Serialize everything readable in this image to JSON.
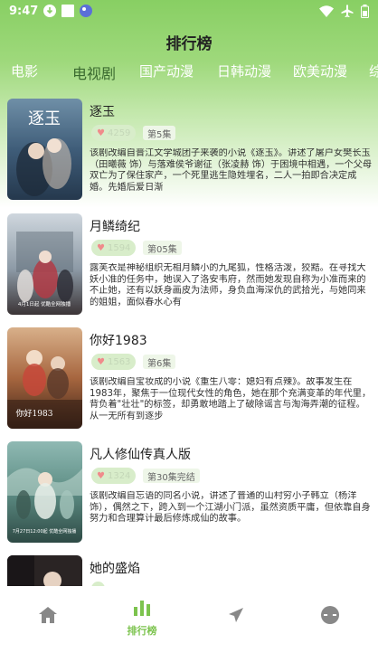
{
  "status_bar": {
    "time": "9:47"
  },
  "header": {
    "title": "排行榜"
  },
  "tabs": [
    {
      "label": "电影"
    },
    {
      "label": "电视剧"
    },
    {
      "label": "国产动漫"
    },
    {
      "label": "日韩动漫"
    },
    {
      "label": "欧美动漫"
    },
    {
      "label": "综"
    }
  ],
  "active_tab": "电视剧",
  "items": [
    {
      "title": "逐玉",
      "heat": "4259",
      "episodes": "第5集",
      "poster_caption": "逐玉",
      "description": "该剧改编自晋江文学城团子来袭的小说《逐玉》。讲述了屠户女樊长玉（田曦薇 饰）与落难侯爷谢征（张凌赫 饰）于困境中相遇，一个父母双亡为了保住家产，一个死里逃生隐姓埋名，二人一拍即合决定成婚。先婚后爱日渐"
    },
    {
      "title": "月鳞绮纪",
      "heat": "1594",
      "episodes": "第05集",
      "poster_caption": "4月1日起 优酷全网独播",
      "description": "露芙衣是神秘组织无相月鳞小的九尾狐，性格活泼，狡黠。在寻找大妖小准的任务中，她误入了洛安韦府，然而她发现自称为小准而来的不止她，还有以妖身画皮为法师，身负血海深仇的武拾光，与她同来的姐姐，面似春水心有"
    },
    {
      "title": "你好1983",
      "heat": "1563",
      "episodes": "第6集",
      "poster_caption": "你好1983",
      "description": "该剧改编自宝妆成的小说《重生八零：媳妇有点辣》。故事发生在1983年，聚焦于一位现代女性的角色，她在那个充满变革的年代里，背负着\"壮壮\"的标签，却勇敢地踏上了破除谣言与淘海弄潮的征程。从一无所有到逐步"
    },
    {
      "title": "凡人修仙传真人版",
      "heat": "1324",
      "episodes": "第30集完结",
      "poster_caption": "7月27日12:00起 优酷全网独播",
      "description": "该剧改编自忘语的同名小说，讲述了普通的山村穷小子韩立（杨洋 饰），偶然之下，跨入到一个江湖小门派，虽然资质平庸，但依靠自身努力和合理算计最后修炼成仙的故事。"
    },
    {
      "title": "她的盛焰",
      "heat": "",
      "episodes": "",
      "poster_caption": "",
      "description": ""
    }
  ],
  "bottom_nav": [
    {
      "label": "",
      "icon": "home-icon"
    },
    {
      "label": "排行榜",
      "icon": "ranking-icon"
    },
    {
      "label": "",
      "icon": "send-icon"
    },
    {
      "label": "",
      "icon": "profile-icon"
    }
  ],
  "colors": {
    "accent": "#7cc34e",
    "header_green": "#88cf63",
    "active_tab": "#3a6a2f"
  }
}
